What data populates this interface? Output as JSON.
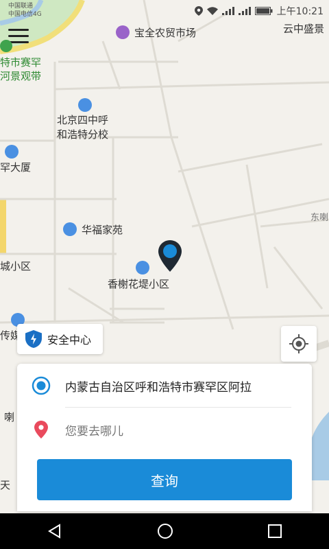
{
  "status": {
    "carrier1": "中国联通",
    "carrier2": "中国电信4G",
    "time": "上午10:21"
  },
  "map_labels": {
    "market": "宝全农贸市场",
    "park_line1": "特市赛罕",
    "park_line2": "河景观带",
    "school_line1": "北京四中呼",
    "school_line2": "和浩特分校",
    "building": "罕大厦",
    "huafu": "华福家苑",
    "xiangshu": "香榭花堤小区",
    "cheng": "城小区",
    "top_right": "云中盛景",
    "east": "东喇",
    "media": "传媒",
    "la": "喇",
    "tian": "天"
  },
  "safety": {
    "label": "安全中心"
  },
  "search": {
    "origin": "内蒙古自治区呼和浩特市赛罕区阿拉",
    "destination_placeholder": "您要去哪儿",
    "button": "查询"
  },
  "colors": {
    "accent": "#1a8bd8",
    "dest_pin": "#e94a5d"
  }
}
